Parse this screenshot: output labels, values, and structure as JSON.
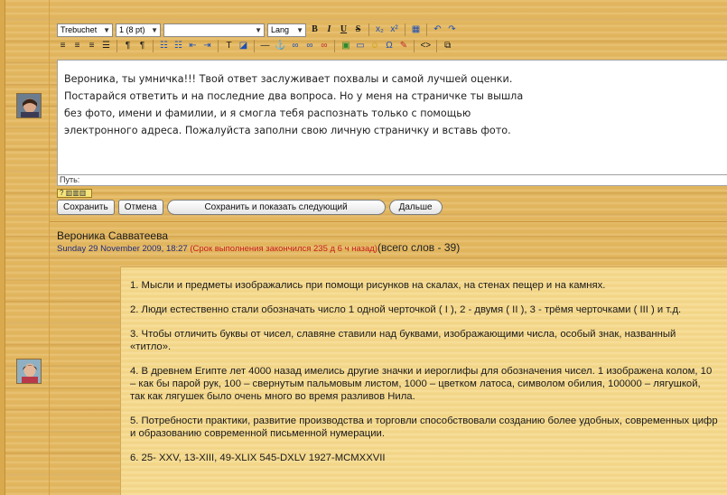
{
  "toolbar": {
    "font_family": "Trebuchet",
    "font_size": "1 (8 pt)",
    "heading": "",
    "lang": "Lang",
    "bold": "B",
    "italic": "I",
    "underline": "U",
    "strike": "S",
    "subscript": "x₂",
    "superscript": "x²",
    "undo": "↶",
    "redo": "↷"
  },
  "editor": {
    "text": "Вероника, ты умничка!!! Твой ответ заслуживает похвалы и самой лучшей оценки. Постарайся ответить и на последние два вопроса. Но у меня на страничке ты вышла без фото, имени и фамилии, и я смогла тебя распознать только с помощью электронного адреса. Пожалуйста заполни свою личную страничку и вставь фото.",
    "path_label": "Путь:"
  },
  "buttons": {
    "save": "Сохранить",
    "cancel": "Отмена",
    "save_next": "Сохранить и показать следующий",
    "next": "Дальше"
  },
  "post": {
    "author": "Вероника Савватеева",
    "date": "Sunday 29 November 2009, 18:27",
    "late_note": "(Срок выполнения закончился 235 д 6 ч назад)",
    "word_count": "(всего слов - 39)",
    "paragraphs": [
      "1. Мысли и предметы изображались при помощи рисунков на скалах, на стенах пещер и на камнях.",
      "2. Люди естественно стали обозначать число 1 одной черточкой ( I ), 2 - двумя ( II ), 3 - трёмя черточками ( III ) и т.д.",
      "3. Чтобы отличить буквы от чисел, славяне ставили над буквами, изображающими числа, особый знак, названный «титло».",
      "4. В древнем Египте лет 4000 назад имелись другие значки и иероглифы для обозначения чисел. 1 изображена колом, 10 – как бы парой рук, 100 – свернутым пальмовым листом, 1000 – цветком латоса, символом обилия, 100000 – лягушкой, так как лягушек было очень много во время разливов Нила.",
      "5. Потребности практики, развитие производства и торговли способствовали созданию более удобных, современных цифр и образованию современной письменной нумерации.",
      "6. 25- XXV, 13-XIII, 49-XLIX 545-DXLV 1927-MCMXXVII"
    ]
  },
  "colors": {
    "background": "#e4b860",
    "post_body": "#f5d98c",
    "late_note": "#c81e1e",
    "date": "#1f2a7a"
  }
}
